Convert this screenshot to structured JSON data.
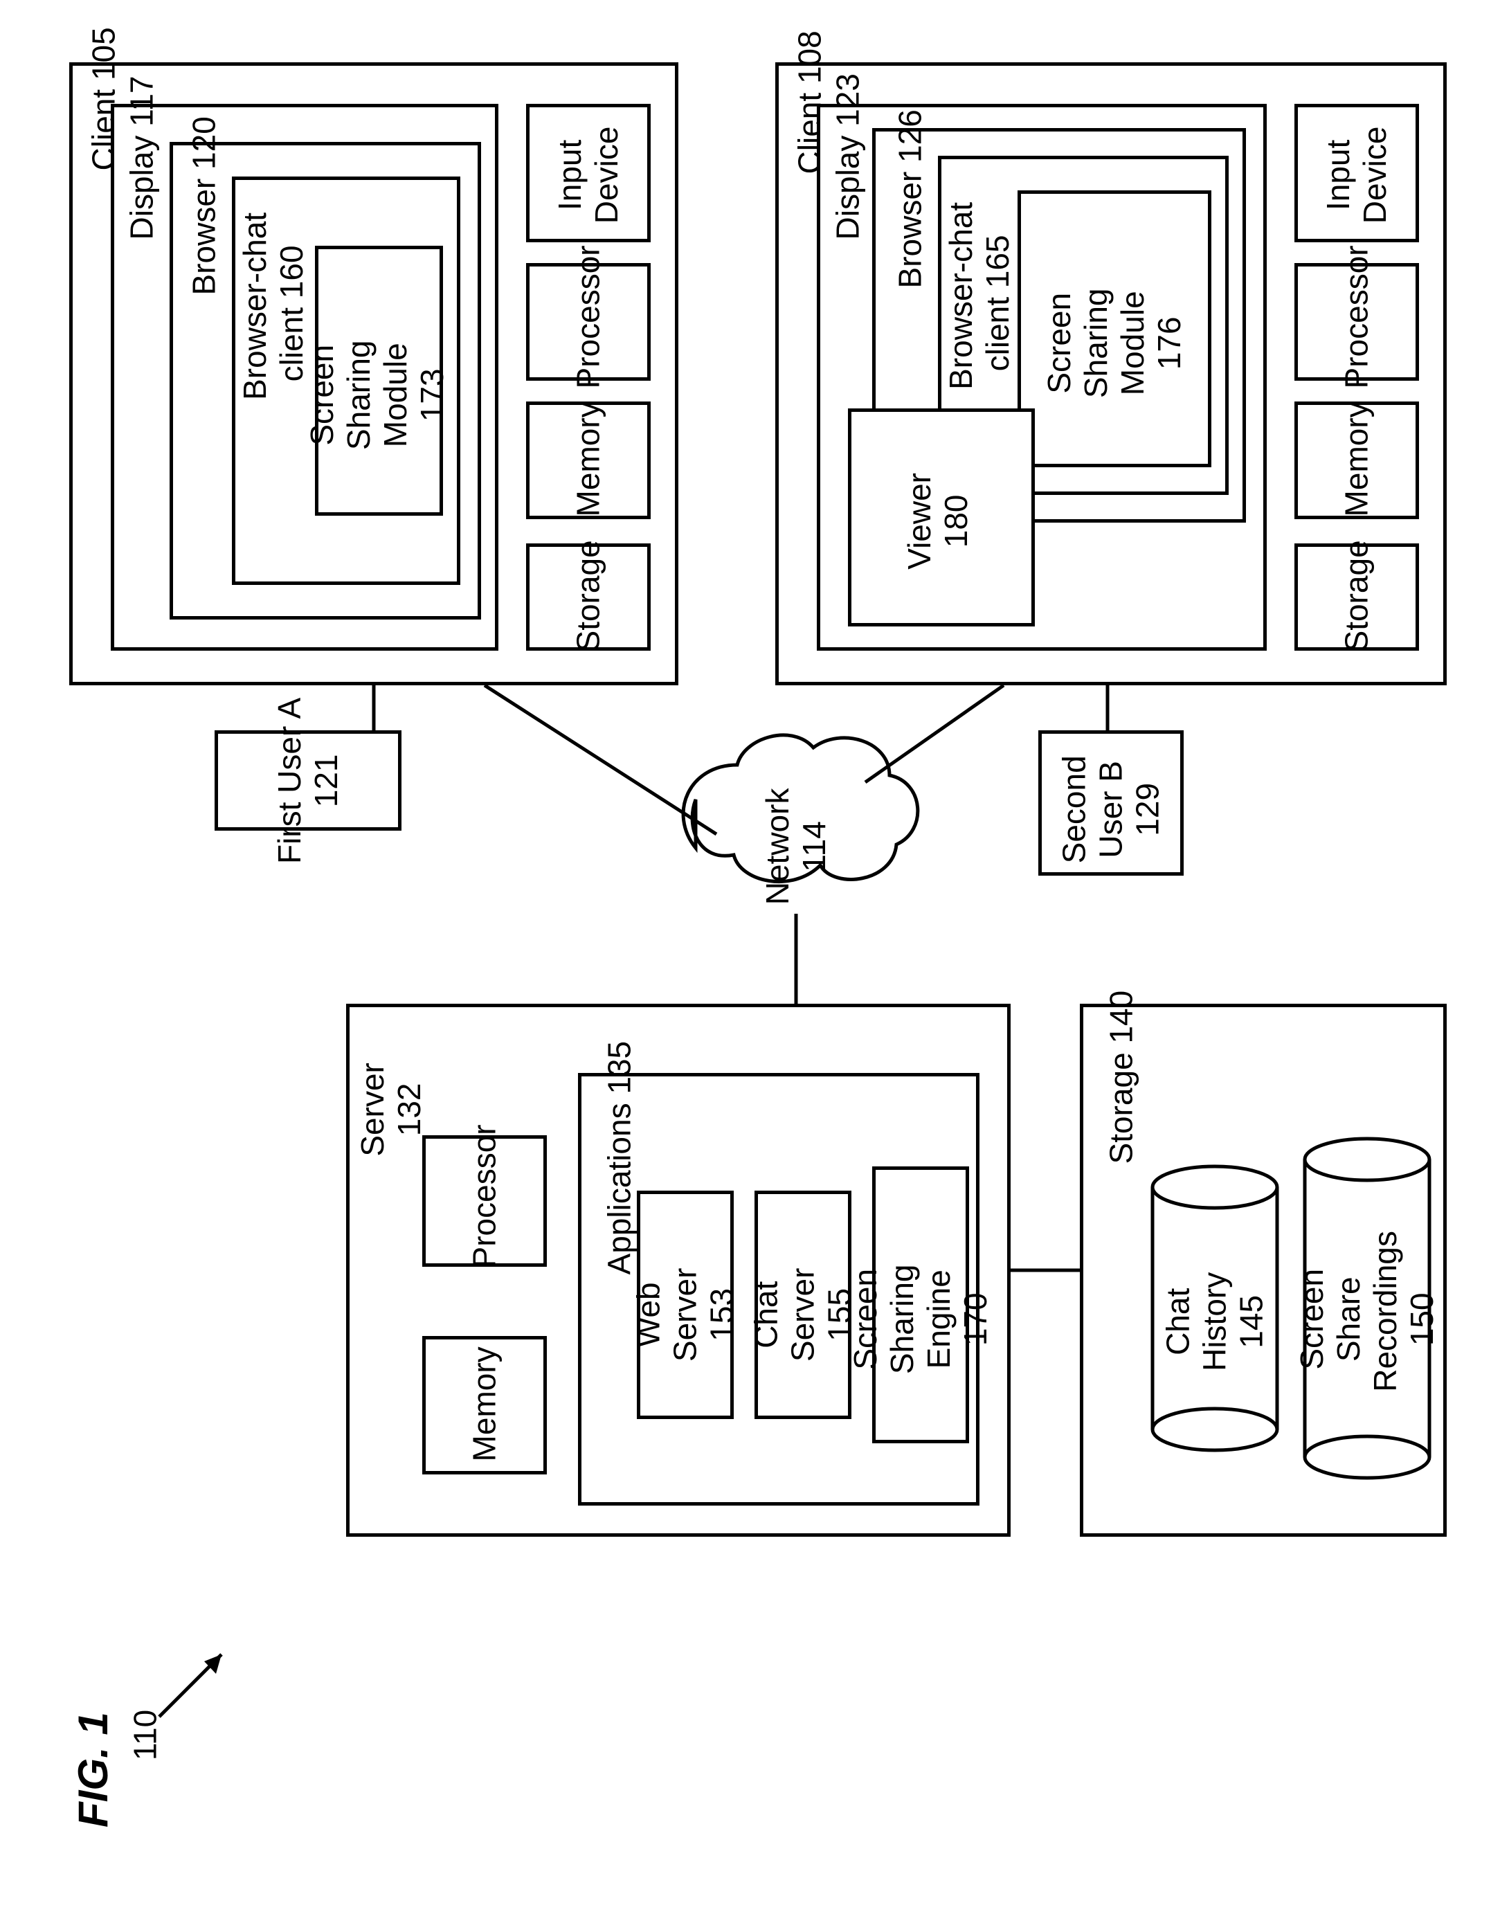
{
  "figure": {
    "title": "FIG. 1",
    "ref": "110"
  },
  "client105": {
    "title": "Client 105",
    "display": "Display 117",
    "browser": "Browser 120",
    "chatClient": "Browser-chat\nclient 160",
    "screenShare": "Screen\nSharing\nModule\n173",
    "input": "Input\nDevice",
    "processor": "Processor",
    "memory": "Memory",
    "storage": "Storage",
    "user": "First User A\n121"
  },
  "client108": {
    "title": "Client 108",
    "display": "Display 123",
    "browser": "Browser 126",
    "chatClient": "Browser-chat\nclient 165",
    "screenShare": "Screen\nSharing\nModule\n176",
    "viewer": "Viewer\n180",
    "input": "Input\nDevice",
    "processor": "Processor",
    "memory": "Memory",
    "storage": "Storage",
    "user": "Second\nUser B\n129"
  },
  "network": "Network\n114",
  "server": {
    "title": "Server\n132",
    "processor": "Processor",
    "memory": "Memory",
    "apps": "Applications 135",
    "web": "Web\nServer\n153",
    "chat": "Chat\nServer\n155",
    "sse": "Screen\nSharing\nEngine\n170"
  },
  "storage140": {
    "title": "Storage 140",
    "chatHistory": "Chat\nHistory\n145",
    "screenRec": "Screen\nShare\nRecordings\n150"
  }
}
